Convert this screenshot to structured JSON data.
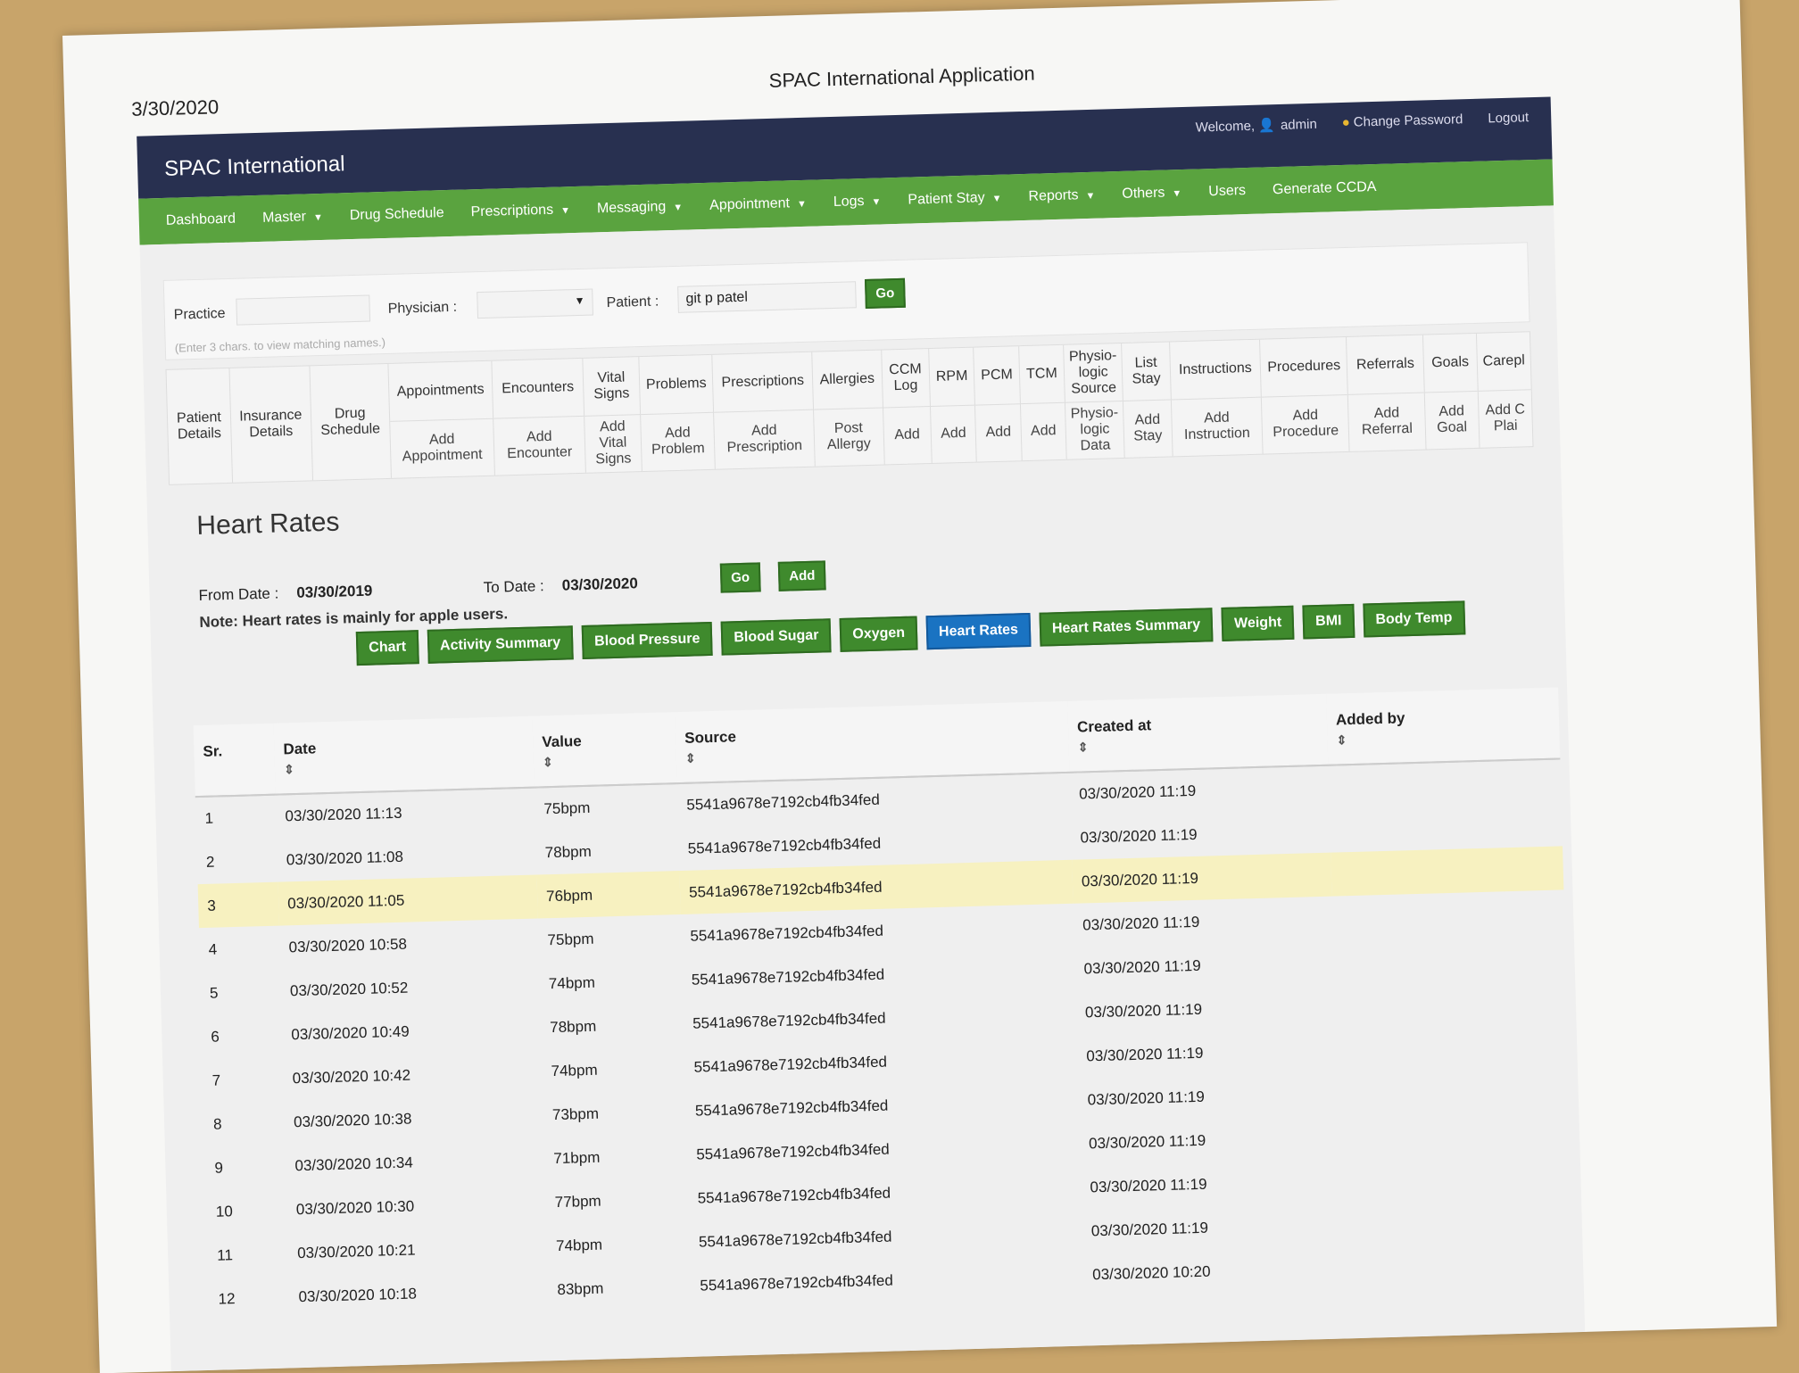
{
  "print": {
    "date": "3/30/2020",
    "title": "SPAC International Application"
  },
  "header": {
    "brand": "SPAC International",
    "welcome": "Welcome,",
    "user": "admin",
    "change_password": "Change Password",
    "logout": "Logout"
  },
  "nav": {
    "dashboard": "Dashboard",
    "master": "Master",
    "drug_schedule": "Drug Schedule",
    "prescriptions": "Prescriptions",
    "messaging": "Messaging",
    "appointment": "Appointment",
    "logs": "Logs",
    "patient_stay": "Patient Stay",
    "reports": "Reports",
    "others": "Others",
    "users": "Users",
    "generate_ccda": "Generate CCDA"
  },
  "filter": {
    "practice_label": "Practice",
    "physician_label": "Physician :",
    "patient_label": "Patient :",
    "patient_value": "git p patel",
    "go": "Go",
    "hint": "(Enter 3 chars. to view matching names.)"
  },
  "quick_links": {
    "patient_details": "Patient\nDetails",
    "insurance_details": "Insurance\nDetails",
    "drug_schedule": "Drug\nSchedule",
    "appointments": "Appointments",
    "add_appointment": "Add\nAppointment",
    "encounters": "Encounters",
    "add_encounter": "Add\nEncounter",
    "vital_signs": "Vital\nSigns",
    "add_vital_signs": "Add\nVital\nSigns",
    "problems": "Problems",
    "add_problem": "Add\nProblem",
    "prescriptions": "Prescriptions",
    "add_prescription": "Add\nPrescription",
    "allergies": "Allergies",
    "post_allergy": "Post\nAllergy",
    "ccm_log": "CCM\nLog",
    "rpm": "RPM",
    "pcm": "PCM",
    "tcm": "TCM",
    "add": "Add",
    "physiologic_source": "Physio-\nlogic\nSource",
    "physiologic_data": "Physio-\nlogic\nData",
    "list_stay": "List\nStay",
    "add_stay": "Add\nStay",
    "instructions": "Instructions",
    "add_instruction": "Add\nInstruction",
    "procedures": "Procedures",
    "add_procedure": "Add\nProcedure",
    "referrals": "Referrals",
    "add_referral": "Add\nReferral",
    "goals": "Goals",
    "add_goal": "Add\nGoal",
    "careplan": "Carepl",
    "add_careplan": "Add C\nPlai"
  },
  "page": {
    "title": "Heart Rates",
    "from_label": "From Date :",
    "from_value": "03/30/2019",
    "to_label": "To Date :",
    "to_value": "03/30/2020",
    "go": "Go",
    "add": "Add",
    "note": "Note: Heart rates is mainly for apple users."
  },
  "tabs": {
    "chart": "Chart",
    "activity_summary": "Activity Summary",
    "blood_pressure": "Blood Pressure",
    "blood_sugar": "Blood Sugar",
    "oxygen": "Oxygen",
    "heart_rates": "Heart Rates",
    "heart_rates_summary": "Heart Rates Summary",
    "weight": "Weight",
    "bmi": "BMI",
    "body_temp": "Body Temp"
  },
  "table": {
    "headers": {
      "sr": "Sr.",
      "date": "Date",
      "value": "Value",
      "source": "Source",
      "created_at": "Created at",
      "added_by": "Added by"
    },
    "rows": [
      {
        "sr": "1",
        "date": "03/30/2020 11:13",
        "value": "75bpm",
        "source": "5541a9678e7192cb4fb34fed",
        "created": "03/30/2020 11:19",
        "by": ""
      },
      {
        "sr": "2",
        "date": "03/30/2020 11:08",
        "value": "78bpm",
        "source": "5541a9678e7192cb4fb34fed",
        "created": "03/30/2020 11:19",
        "by": ""
      },
      {
        "sr": "3",
        "date": "03/30/2020 11:05",
        "value": "76bpm",
        "source": "5541a9678e7192cb4fb34fed",
        "created": "03/30/2020 11:19",
        "by": ""
      },
      {
        "sr": "4",
        "date": "03/30/2020 10:58",
        "value": "75bpm",
        "source": "5541a9678e7192cb4fb34fed",
        "created": "03/30/2020 11:19",
        "by": ""
      },
      {
        "sr": "5",
        "date": "03/30/2020 10:52",
        "value": "74bpm",
        "source": "5541a9678e7192cb4fb34fed",
        "created": "03/30/2020 11:19",
        "by": ""
      },
      {
        "sr": "6",
        "date": "03/30/2020 10:49",
        "value": "78bpm",
        "source": "5541a9678e7192cb4fb34fed",
        "created": "03/30/2020 11:19",
        "by": ""
      },
      {
        "sr": "7",
        "date": "03/30/2020 10:42",
        "value": "74bpm",
        "source": "5541a9678e7192cb4fb34fed",
        "created": "03/30/2020 11:19",
        "by": ""
      },
      {
        "sr": "8",
        "date": "03/30/2020 10:38",
        "value": "73bpm",
        "source": "5541a9678e7192cb4fb34fed",
        "created": "03/30/2020 11:19",
        "by": ""
      },
      {
        "sr": "9",
        "date": "03/30/2020 10:34",
        "value": "71bpm",
        "source": "5541a9678e7192cb4fb34fed",
        "created": "03/30/2020 11:19",
        "by": ""
      },
      {
        "sr": "10",
        "date": "03/30/2020 10:30",
        "value": "77bpm",
        "source": "5541a9678e7192cb4fb34fed",
        "created": "03/30/2020 11:19",
        "by": ""
      },
      {
        "sr": "11",
        "date": "03/30/2020 10:21",
        "value": "74bpm",
        "source": "5541a9678e7192cb4fb34fed",
        "created": "03/30/2020 11:19",
        "by": ""
      },
      {
        "sr": "12",
        "date": "03/30/2020 10:18",
        "value": "83bpm",
        "source": "5541a9678e7192cb4fb34fed",
        "created": "03/30/2020 10:20",
        "by": ""
      }
    ]
  }
}
